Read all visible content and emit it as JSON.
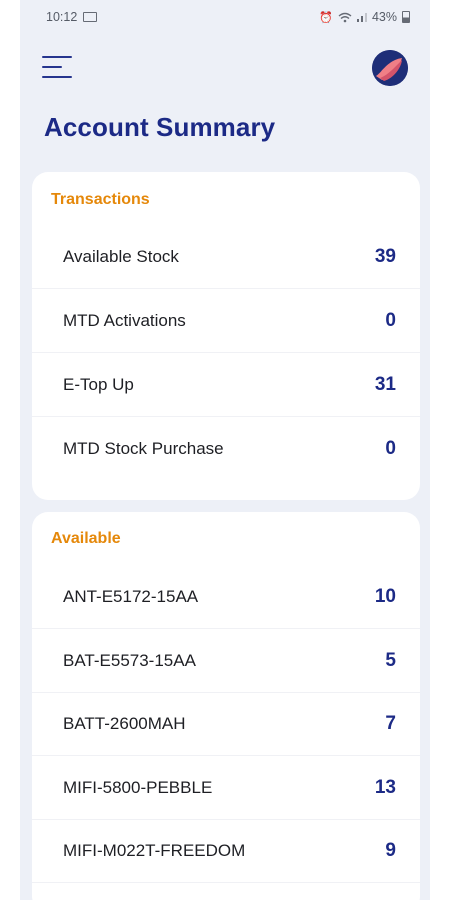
{
  "status_bar": {
    "time": "10:12",
    "battery": "43%",
    "icons": [
      "laptop-icon",
      "alarm-icon",
      "wifi-icon",
      "signal-icon",
      "battery-icon"
    ]
  },
  "header": {
    "menu_icon": "hamburger-menu-icon",
    "title": "Account Summary",
    "avatar": "user-avatar"
  },
  "transactions": {
    "label": "Transactions",
    "items": [
      {
        "label": "Available Stock",
        "value": "39"
      },
      {
        "label": "MTD Activations",
        "value": "0"
      },
      {
        "label": "E-Top Up",
        "value": "31"
      },
      {
        "label": "MTD Stock Purchase",
        "value": "0"
      }
    ]
  },
  "available": {
    "label": "Available",
    "items": [
      {
        "label": "ANT-E5172-15AA",
        "value": "10"
      },
      {
        "label": "BAT-E5573-15AA",
        "value": "5"
      },
      {
        "label": "BATT-2600MAH",
        "value": "7"
      },
      {
        "label": "MIFI-5800-PEBBLE",
        "value": "13"
      },
      {
        "label": "MIFI-M022T-FREEDOM",
        "value": "9"
      }
    ]
  },
  "colors": {
    "title": "#1c2a86",
    "section_label": "#e5880a",
    "background": "#edf0f7",
    "card": "#ffffff"
  }
}
